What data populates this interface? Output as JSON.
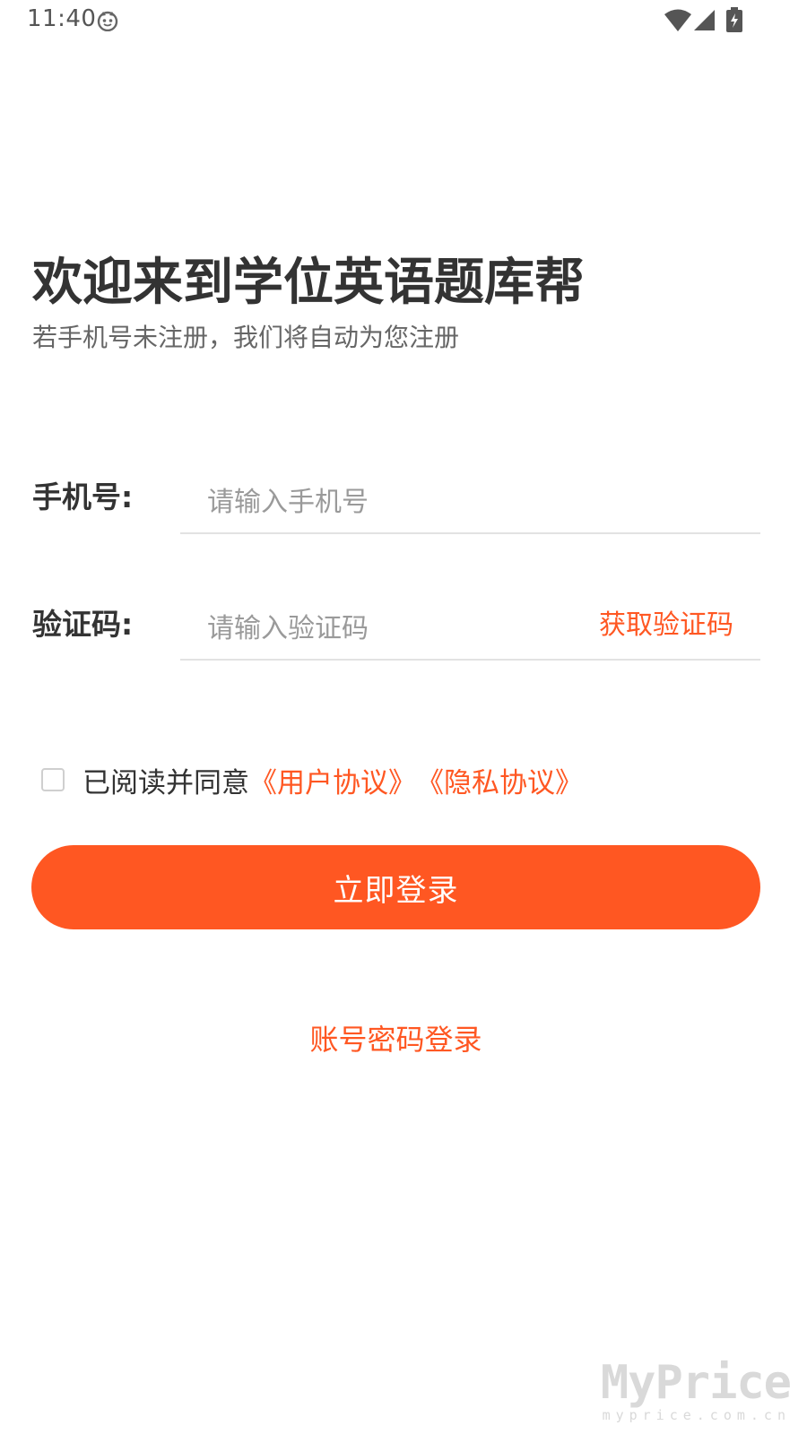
{
  "status_bar": {
    "time": "11:40",
    "icons": [
      "face-icon",
      "wifi-icon",
      "signal-icon",
      "battery-charging-icon"
    ]
  },
  "header": {
    "title": "欢迎来到学位英语题库帮",
    "subtitle": "若手机号未注册，我们将自动为您注册"
  },
  "form": {
    "phone_label": "手机号:",
    "phone_placeholder": "请输入手机号",
    "code_label": "验证码:",
    "code_placeholder": "请输入验证码",
    "get_code_label": "获取验证码"
  },
  "agreement": {
    "checked": false,
    "prefix": "已阅读并同意",
    "user_agreement": "《用户协议》",
    "privacy_policy": "《隐私协议》"
  },
  "actions": {
    "login_label": "立即登录",
    "password_login_label": "账号密码登录"
  },
  "watermark": {
    "logo": "MyPrice",
    "domain": "myprice.com.cn"
  },
  "colors": {
    "accent": "#ff5722",
    "title": "#333333",
    "subtitle": "#666666",
    "placeholder": "#9a9a9a",
    "divider": "#e2e2e2"
  }
}
